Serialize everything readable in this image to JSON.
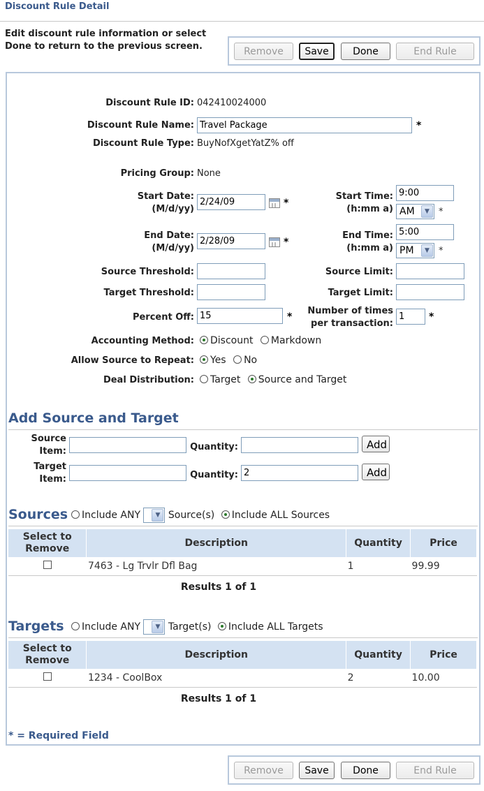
{
  "page": {
    "title": "Discount Rule Detail",
    "instructions": "Edit discount rule information or select Done to return to the previous screen."
  },
  "buttons": {
    "remove": "Remove",
    "save": "Save",
    "done": "Done",
    "end_rule": "End Rule"
  },
  "form": {
    "rule_id_label": "Discount Rule ID:",
    "rule_id_value": "042410024000",
    "rule_name_label": "Discount Rule Name:",
    "rule_name_value": "Travel Package",
    "rule_type_label": "Discount Rule Type:",
    "rule_type_value": "BuyNofXgetYatZ% off",
    "pricing_group_label": "Pricing Group:",
    "pricing_group_value": "None",
    "start_date_label": "Start Date:",
    "date_format": "(M/d/yy)",
    "start_date_value": "2/24/09",
    "start_time_label": "Start Time:",
    "time_format": "(h:mm a)",
    "start_time_value": "9:00",
    "start_ampm": "AM",
    "end_date_label": "End Date:",
    "end_date_value": "2/28/09",
    "end_time_label": "End Time:",
    "end_time_value": "5:00",
    "end_ampm": "PM",
    "source_threshold_label": "Source Threshold:",
    "source_threshold_value": "",
    "source_limit_label": "Source Limit:",
    "source_limit_value": "",
    "target_threshold_label": "Target Threshold:",
    "target_threshold_value": "",
    "target_limit_label": "Target Limit:",
    "target_limit_value": "",
    "percent_off_label": "Percent Off:",
    "percent_off_value": "15",
    "times_per_tx_label_1": "Number of times",
    "times_per_tx_label_2": "per transaction:",
    "times_per_tx_value": "1",
    "accounting_label": "Accounting Method:",
    "accounting_opt_discount": "Discount",
    "accounting_opt_markdown": "Markdown",
    "repeat_label": "Allow Source to Repeat:",
    "repeat_yes": "Yes",
    "repeat_no": "No",
    "distribution_label": "Deal Distribution:",
    "distribution_target": "Target",
    "distribution_source_target": "Source and Target",
    "required_star": "*"
  },
  "add_section": {
    "title": "Add Source and Target",
    "source_item_label_1": "Source",
    "source_item_label_2": "Item:",
    "source_item_value": "",
    "source_qty_label": "Quantity:",
    "source_qty_value": "",
    "target_item_label_1": "Target",
    "target_item_label_2": "Item:",
    "target_item_value": "",
    "target_qty_label": "Quantity:",
    "target_qty_value": "2",
    "add_label": "Add"
  },
  "sources": {
    "title": "Sources",
    "include_any": "Include ANY",
    "suffix": "Source(s)",
    "include_all": "Include ALL Sources",
    "headers": [
      "Select to Remove",
      "Description",
      "Quantity",
      "Price"
    ],
    "rows": [
      {
        "description": "7463 - Lg Trvlr Dfl Bag",
        "quantity": "1",
        "price": "99.99"
      }
    ],
    "results": "Results 1 of 1"
  },
  "targets": {
    "title": "Targets",
    "include_any": "Include ANY",
    "suffix": "Target(s)",
    "include_all": "Include ALL Targets",
    "headers": [
      "Select to Remove",
      "Description",
      "Quantity",
      "Price"
    ],
    "rows": [
      {
        "description": "1234 - CoolBox",
        "quantity": "2",
        "price": "10.00"
      }
    ],
    "results": "Results 1 of 1"
  },
  "footer": {
    "required_note": "* = Required Field"
  },
  "icons": {
    "calendar": "calendar-icon",
    "dropdown": "chevron-down-icon"
  }
}
